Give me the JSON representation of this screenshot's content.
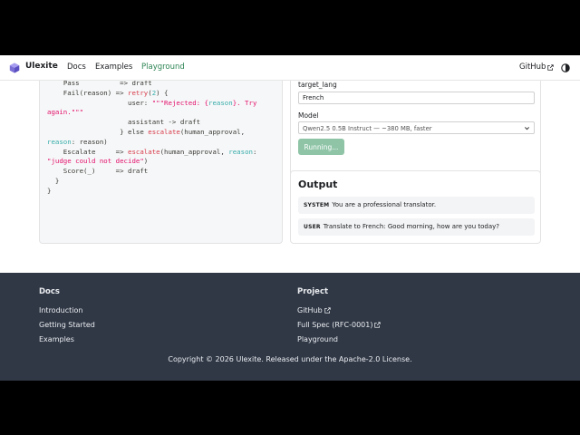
{
  "navbar": {
    "brand": "Ulexite",
    "links": [
      {
        "label": "Docs",
        "active": false
      },
      {
        "label": "Examples",
        "active": false
      },
      {
        "label": "Playground",
        "active": true
      }
    ],
    "github_label": "GitHub",
    "accent_color": "#2e8555"
  },
  "code": {
    "lines": [
      [
        {
          "t": "    ",
          "c": "op"
        },
        {
          "t": "Pass",
          "c": "op"
        },
        {
          "t": "          => draft",
          "c": "op"
        }
      ],
      [
        {
          "t": "    Fail(reason) => ",
          "c": "op"
        },
        {
          "t": "retry",
          "c": "fn"
        },
        {
          "t": "(",
          "c": "op"
        },
        {
          "t": "2",
          "c": "num"
        },
        {
          "t": ") {",
          "c": "op"
        }
      ],
      [
        {
          "t": "                    user: ",
          "c": "op"
        },
        {
          "t": "\"\"\"Rejected: {",
          "c": "str"
        },
        {
          "t": "reason",
          "c": "prop"
        },
        {
          "t": "}. Try",
          "c": "str"
        }
      ],
      [
        {
          "t": "again.\"\"\"",
          "c": "str"
        }
      ],
      [
        {
          "t": "                    assistant -> draft",
          "c": "op"
        }
      ],
      [
        {
          "t": "                  } else ",
          "c": "op"
        },
        {
          "t": "escalate",
          "c": "fn"
        },
        {
          "t": "(human_approval,",
          "c": "op"
        }
      ],
      [
        {
          "t": "reason",
          "c": "prop"
        },
        {
          "t": ": reason)",
          "c": "op"
        }
      ],
      [
        {
          "t": "    Escalate     => ",
          "c": "op"
        },
        {
          "t": "escalate",
          "c": "fn"
        },
        {
          "t": "(human_approval, ",
          "c": "op"
        },
        {
          "t": "reason",
          "c": "prop"
        },
        {
          "t": ":",
          "c": "op"
        }
      ],
      [
        {
          "t": "\"judge could not decide\"",
          "c": "str"
        },
        {
          "t": ")",
          "c": "op"
        }
      ],
      [
        {
          "t": "    Score(_)     => draft",
          "c": "op"
        }
      ],
      [
        {
          "t": "  }",
          "c": "op"
        }
      ],
      [
        {
          "t": "}",
          "c": "op"
        }
      ]
    ]
  },
  "form": {
    "target_lang_label": "target_lang",
    "target_lang_value": "French",
    "model_label": "Model",
    "model_selected": "Qwen2.5 0.5B Instruct — ~380 MB, faster",
    "run_button": "Running..."
  },
  "output": {
    "title": "Output",
    "messages": [
      {
        "role": "SYSTEM",
        "text": "You are a professional translator."
      },
      {
        "role": "USER",
        "text": "Translate to French: Good morning, how are you today?"
      }
    ]
  },
  "footer": {
    "docs_heading": "Docs",
    "docs_links": [
      "Introduction",
      "Getting Started",
      "Examples"
    ],
    "project_heading": "Project",
    "project_links": [
      {
        "label": "GitHub",
        "external": true
      },
      {
        "label": "Full Spec (RFC-0001)",
        "external": true
      },
      {
        "label": "Playground",
        "external": false
      }
    ],
    "copyright": "Copyright © 2026 Ulexite. Released under the Apache-2.0 License."
  }
}
